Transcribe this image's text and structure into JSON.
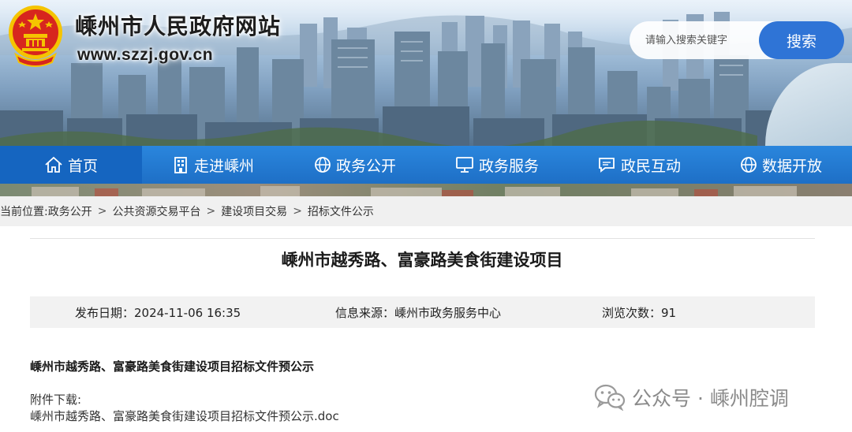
{
  "header": {
    "site_title": "嵊州市人民政府网站",
    "site_url": "www.szzj.gov.cn",
    "search": {
      "placeholder": "请输入搜索关键字",
      "button_label": "搜索"
    }
  },
  "nav": {
    "items": [
      {
        "label": "首页",
        "icon": "home-icon"
      },
      {
        "label": "走进嵊州",
        "icon": "building-icon"
      },
      {
        "label": "政务公开",
        "icon": "globe-icon"
      },
      {
        "label": "政务服务",
        "icon": "monitor-icon"
      },
      {
        "label": "政民互动",
        "icon": "chat-icon"
      },
      {
        "label": "数据开放",
        "icon": "globe-icon"
      }
    ]
  },
  "breadcrumb": {
    "prefix": "当前位置:",
    "items": [
      "政务公开",
      "公共资源交易平台",
      "建设项目交易",
      "招标文件公示"
    ],
    "separator": ">"
  },
  "article": {
    "title": "嵊州市越秀路、富豪路美食街建设项目",
    "meta": {
      "date": "发布日期：2024-11-06 16:35",
      "source": "信息来源：嵊州市政务服务中心",
      "views": "浏览次数：91"
    },
    "lead": "嵊州市越秀路、富豪路美食街建设项目招标文件预公示",
    "attachment_label": "附件下载:",
    "attachment_file": "嵊州市越秀路、富豪路美食街建设项目招标文件预公示.doc"
  },
  "watermark": {
    "text": "公众号 · 嵊州腔调",
    "icon": "wechat-icon"
  },
  "colors": {
    "nav_blue": "#2a86dd",
    "nav_active": "#1565c0",
    "search_button": "#2f74d6",
    "emblem_red": "#d7261e",
    "emblem_gold": "#f5c400"
  }
}
